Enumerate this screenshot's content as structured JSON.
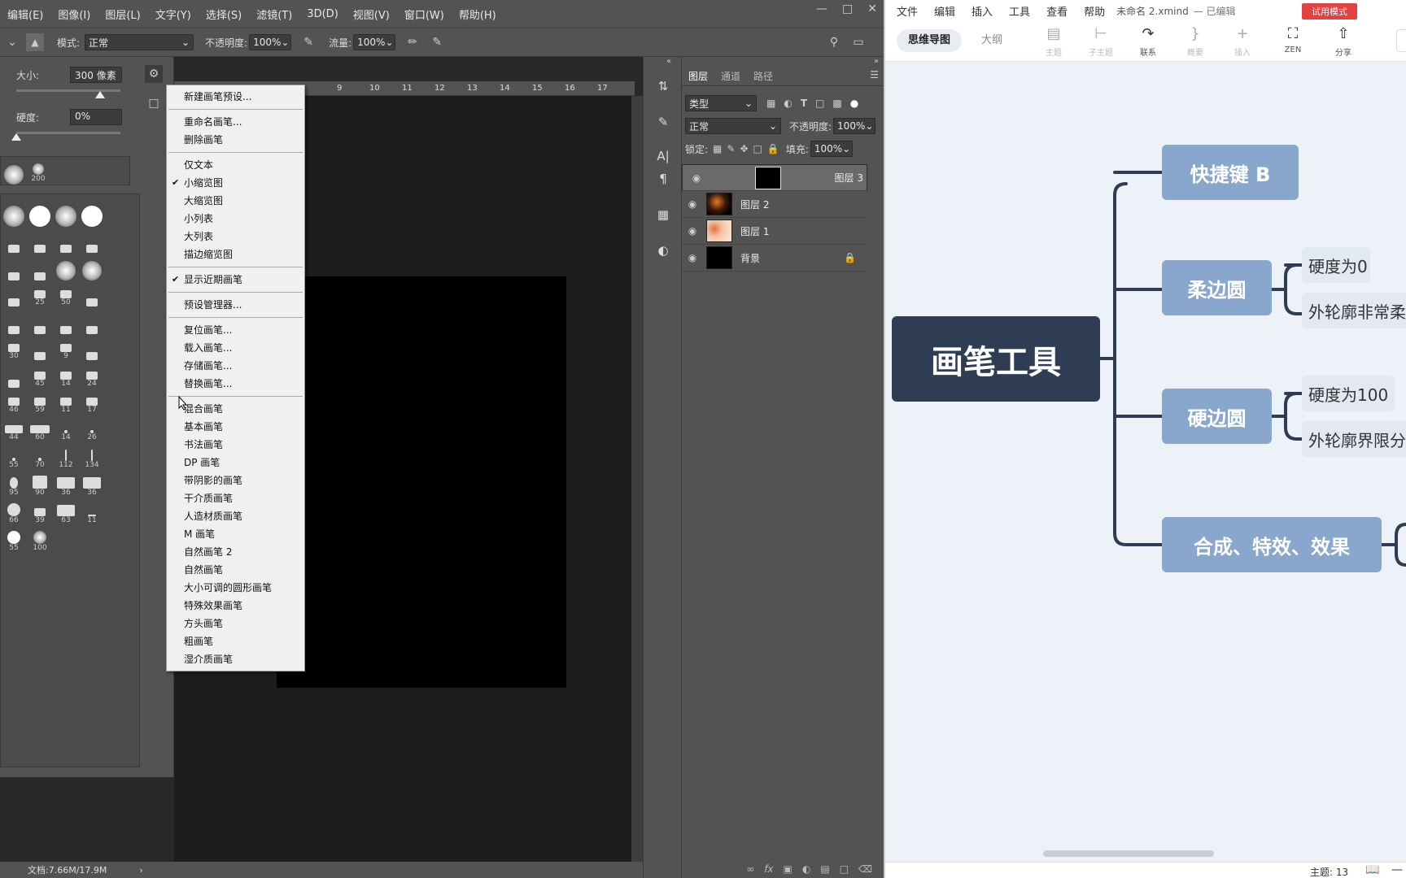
{
  "photoshop": {
    "menu": [
      "编辑(E)",
      "图像(I)",
      "图层(L)",
      "文字(Y)",
      "选择(S)",
      "滤镜(T)",
      "3D(D)",
      "视图(V)",
      "窗口(W)",
      "帮助(H)"
    ],
    "options": {
      "mode_label": "模式:",
      "mode_value": "正常",
      "opacity_label": "不透明度:",
      "opacity_value": "100%",
      "flow_label": "流量:",
      "flow_value": "100%"
    },
    "brush_panel": {
      "size_label": "大小:",
      "size_value": "300 像素",
      "hardness_label": "硬度:",
      "hardness_value": "0%",
      "recent_labels": [
        "200"
      ],
      "grid_labels": [
        "25",
        "50",
        "9",
        "30",
        "45",
        "14",
        "24",
        "46",
        "59",
        "11",
        "17",
        "44",
        "60",
        "14",
        "26",
        "55",
        "70",
        "112",
        "134",
        "95",
        "90",
        "36",
        "36",
        "66",
        "39",
        "63",
        "11",
        "55",
        "100"
      ]
    },
    "ruler_ticks": [
      "9",
      "10",
      "11",
      "12",
      "13",
      "14",
      "15",
      "16",
      "17"
    ],
    "dropdown": {
      "group1": [
        "新建画笔预设..."
      ],
      "group2": [
        "重命名画笔...",
        "删除画笔"
      ],
      "group3": [
        {
          "label": "仅文本",
          "checked": false
        },
        {
          "label": "小缩览图",
          "checked": true
        },
        {
          "label": "大缩览图",
          "checked": false
        },
        {
          "label": "小列表",
          "checked": false
        },
        {
          "label": "大列表",
          "checked": false
        },
        {
          "label": "描边缩览图",
          "checked": false
        }
      ],
      "group4": [
        {
          "label": "显示近期画笔",
          "checked": true
        }
      ],
      "group5": [
        "预设管理器..."
      ],
      "group6": [
        "复位画笔...",
        "载入画笔...",
        "存储画笔...",
        "替换画笔..."
      ],
      "group7": [
        "混合画笔",
        "基本画笔",
        "书法画笔",
        "DP 画笔",
        "带阴影的画笔",
        "干介质画笔",
        "人造材质画笔",
        "M 画笔",
        "自然画笔 2",
        "自然画笔",
        "大小可调的圆形画笔",
        "特殊效果画笔",
        "方头画笔",
        "粗画笔",
        "湿介质画笔"
      ]
    },
    "status": "文档:7.66M/17.9M",
    "layers_panel": {
      "tabs": [
        "图层",
        "通道",
        "路径"
      ],
      "filter_label": "类型",
      "blend_mode": "正常",
      "opacity_label": "不透明度:",
      "opacity_value": "100%",
      "lock_label": "锁定:",
      "fill_label": "填充:",
      "fill_value": "100%",
      "layers": [
        {
          "name": "图层 3",
          "selected": true,
          "thumb": "#000000"
        },
        {
          "name": "图层 2",
          "selected": false,
          "thumb": "#3a1a08"
        },
        {
          "name": "图层 1",
          "selected": false,
          "thumb": "#e8a078"
        },
        {
          "name": "背景",
          "selected": false,
          "thumb": "#000000"
        }
      ]
    }
  },
  "xmind": {
    "menu": [
      "文件",
      "编辑",
      "插入",
      "工具",
      "查看",
      "帮助"
    ],
    "doc_title": "未命名 2.xmind",
    "doc_status": "— 已编辑",
    "trial_badge": "试用模式",
    "tabs": [
      "思维导图",
      "大纲"
    ],
    "toolbar": [
      {
        "label": "主题",
        "icon": "topic-icon"
      },
      {
        "label": "子主题",
        "icon": "subtopic-icon"
      },
      {
        "label": "联系",
        "icon": "relationship-icon"
      },
      {
        "label": "概要",
        "icon": "summary-icon"
      },
      {
        "label": "插入",
        "icon": "plus-icon"
      },
      {
        "label": "ZEN",
        "icon": "fullscreen-icon"
      },
      {
        "label": "分享",
        "icon": "share-icon"
      }
    ],
    "map": {
      "central": "画笔工具",
      "branches": [
        {
          "label": "快捷键  B",
          "children": []
        },
        {
          "label": "柔边圆",
          "children": [
            "硬度为0",
            "外轮廓非常柔"
          ]
        },
        {
          "label": "硬边圆",
          "children": [
            "硬度为100",
            "外轮廓界限分"
          ]
        },
        {
          "label": "合成、特效、效果",
          "children": []
        }
      ]
    },
    "status": "主题: 13",
    "colors": {
      "central": "#2e3c54",
      "main": "#89a7cc",
      "sub": "#e3e9f2",
      "line": "#2e3c54"
    }
  }
}
